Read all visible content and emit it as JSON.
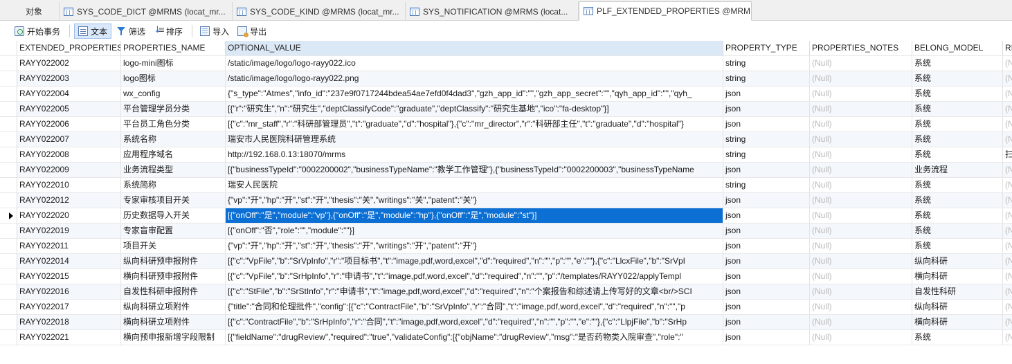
{
  "tabs": [
    {
      "label": "对象",
      "icon": "none"
    },
    {
      "label": "SYS_CODE_DICT @MRMS (locat_mr...",
      "icon": "table-icon"
    },
    {
      "label": "SYS_CODE_KIND @MRMS (locat_mr...",
      "icon": "table-icon"
    },
    {
      "label": "SYS_NOTIFICATION @MRMS (locat...",
      "icon": "table-icon"
    },
    {
      "label": "PLF_EXTENDED_PROPERTIES @MRM...",
      "icon": "table-icon"
    }
  ],
  "toolbar": {
    "begin_transaction": "开始事务",
    "text": "文本",
    "filter": "筛选",
    "sort": "排序",
    "import": "导入",
    "export": "导出"
  },
  "grid": {
    "columns": [
      "EXTENDED_PROPERTIES_",
      "PROPERTIES_NAME",
      "OPTIONAL_VALUE",
      "PROPERTY_TYPE",
      "PROPERTIES_NOTES",
      "BELONG_MODEL",
      "RI"
    ],
    "rows": [
      [
        "RAYY022002",
        "logo-mini图标",
        "/static/image/logo/logo-rayy022.ico",
        "string",
        "(Null)",
        "系统",
        "(N"
      ],
      [
        "RAYY022003",
        "logo图标",
        "/static/image/logo/logo-rayy022.png",
        "string",
        "(Null)",
        "系统",
        "(N"
      ],
      [
        "RAYY022004",
        "wx_config",
        "{\"s_type\":\"Atmes\",\"info_id\":\"237e9f0717244bdea54ae7efd0f4dad3\",\"gzh_app_id\":\"\",\"gzh_app_secret\":\"\",\"qyh_app_id\":\"\",\"qyh_",
        "json",
        "(Null)",
        "系统",
        "(N"
      ],
      [
        "RAYY022005",
        "平台管理学员分类",
        "[{\"r\":\"研究生\",\"n\":\"研究生\",\"deptClassifyCode\":\"graduate\",\"deptClassify\":\"研究生基地\",\"ico\":\"fa-desktop\"}]",
        "json",
        "(Null)",
        "系统",
        "(N"
      ],
      [
        "RAYY022006",
        "平台员工角色分类",
        "[{\"c\":\"mr_staff\",\"r\":\"科研部管理员\",\"t\":\"graduate\",\"d\":\"hospital\"},{\"c\":\"mr_director\",\"r\":\"科研部主任\",\"t\":\"graduate\",\"d\":\"hospital\"}",
        "json",
        "(Null)",
        "系统",
        "(N"
      ],
      [
        "RAYY022007",
        "系统名称",
        "瑞安市人民医院科研管理系统",
        "string",
        "(Null)",
        "系统",
        "(N"
      ],
      [
        "RAYY022008",
        "应用程序域名",
        "http://192.168.0.13:18070/mrms",
        "string",
        "(Null)",
        "系统",
        "扫"
      ],
      [
        "RAYY022009",
        "业务流程类型",
        "[{\"businessTypeId\":\"0002200002\",\"businessTypeName\":\"教学工作管理\"},{\"businessTypeId\":\"0002200003\",\"businessTypeName",
        "json",
        "(Null)",
        "业务流程",
        "(N"
      ],
      [
        "RAYY022010",
        "系统简称",
        "瑞安人民医院",
        "string",
        "(Null)",
        "系统",
        "(N"
      ],
      [
        "RAYY022012",
        "专家审核项目开关",
        "{\"vp\":\"开\",\"hp\":\"开\",\"st\":\"开\",\"thesis\":\"关\",\"writings\":\"关\",\"patent\":\"关\"}",
        "json",
        "(Null)",
        "系统",
        "(N"
      ],
      [
        "RAYY022020",
        "历史数据导入开关",
        "[{\"onOff\":\"是\",\"module\":\"vp\"},{\"onOff\":\"是\",\"module\":\"hp\"},{\"onOff\":\"是\",\"module\":\"st\"}]",
        "json",
        "(Null)",
        "系统",
        "(N"
      ],
      [
        "RAYY022019",
        "专家盲审配置",
        "[{\"onOff\":\"否\",\"role\":\"\",\"module\":\"\"}]",
        "json",
        "(Null)",
        "系统",
        "(N"
      ],
      [
        "RAYY022011",
        "项目开关",
        "{\"vp\":\"开\",\"hp\":\"开\",\"st\":\"开\",\"thesis\":\"开\",\"writings\":\"开\",\"patent\":\"开\"}",
        "json",
        "(Null)",
        "系统",
        "(N"
      ],
      [
        "RAYY022014",
        "纵向科研预申报附件",
        "[{\"c\":\"VpFile\",\"b\":\"SrVpInfo\",\"r\":\"项目标书\",\"t\":\"image,pdf,word,excel\",\"d\":\"required\",\"n\":\"\",\"p\":\"\",\"e\":\"\"},{\"c\":\"LlcxFile\",\"b\":\"SrVpI",
        "json",
        "(Null)",
        "纵向科研",
        "(N"
      ],
      [
        "RAYY022015",
        "横向科研预申报附件",
        "[{\"c\":\"VpFile\",\"b\":\"SrHpInfo\",\"r\":\"申请书\",\"t\":\"image,pdf,word,excel\",\"d\":\"required\",\"n\":\"\",\"p\":\"/templates/RAYY022/applyTempl",
        "json",
        "(Null)",
        "横向科研",
        "(N"
      ],
      [
        "RAYY022016",
        "自发性科研申报附件",
        "[{\"c\":\"StFile\",\"b\":\"SrStInfo\",\"r\":\"申请书\",\"t\":\"image,pdf,word,excel\",\"d\":\"required\",\"n\":\"个案报告和综述请上传写好的文章<br/>SCI",
        "json",
        "(Null)",
        "自发性科研",
        "(N"
      ],
      [
        "RAYY022017",
        "纵向科研立项附件",
        "{\"title\":\"合同和伦理批件\",\"config\":[{\"c\":\"ContractFile\",\"b\":\"SrVpInfo\",\"r\":\"合同\",\"t\":\"image,pdf,word,excel\",\"d\":\"required\",\"n\":\"\",\"p",
        "json",
        "(Null)",
        "纵向科研",
        "(N"
      ],
      [
        "RAYY022018",
        "横向科研立项附件",
        "[{\"c\":\"ContractFile\",\"b\":\"SrHpInfo\",\"r\":\"合同\",\"t\":\"image,pdf,word,excel\",\"d\":\"required\",\"n\":\"\",\"p\":\"\",\"e\":\"\"},{\"c\":\"LlpjFile\",\"b\":\"SrHp",
        "json",
        "(Null)",
        "横向科研",
        "(N"
      ],
      [
        "RAYY022021",
        "横向预申报新增字段限制",
        "[{\"fieldName\":\"drugReview\",\"required\":\"true\",\"validateConfig\":[{\"objName\":\"drugReview\",\"msg\":\"是否药物类入院审查\",\"role\":\"",
        "json",
        "(Null)",
        "系统",
        "(N"
      ]
    ],
    "selected_row": 10,
    "selected_column": 2
  }
}
